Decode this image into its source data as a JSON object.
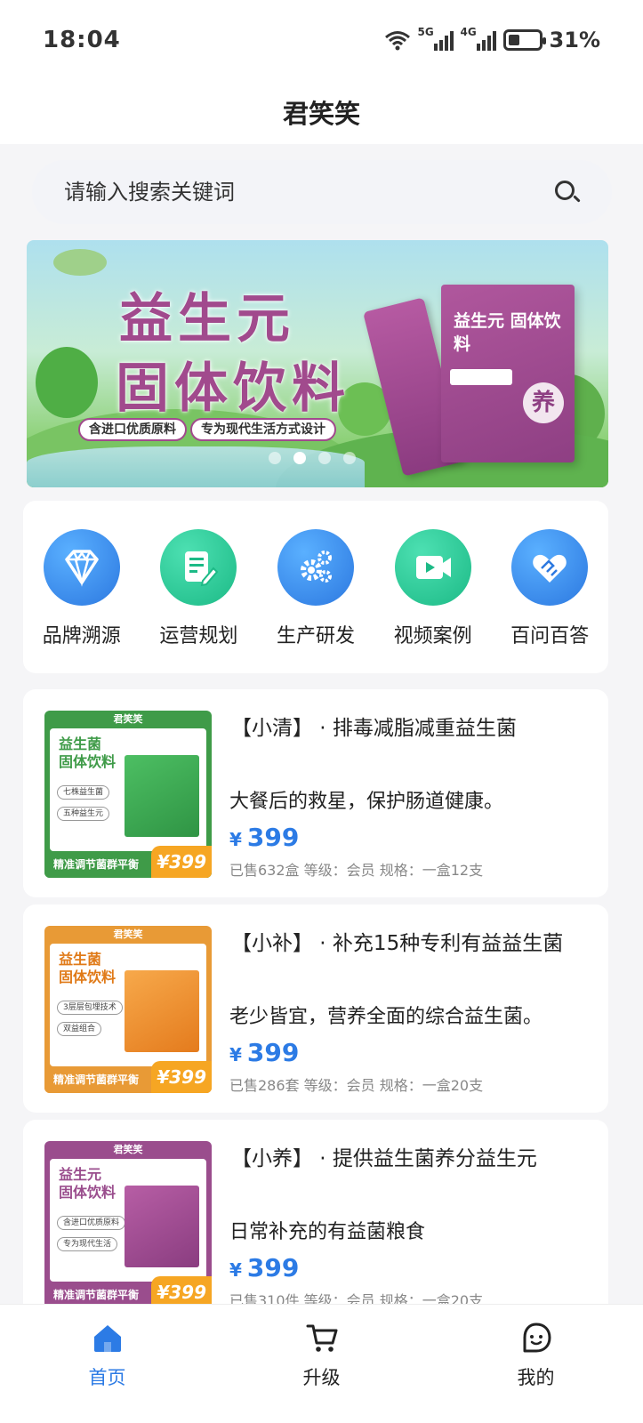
{
  "status_bar": {
    "time": "18:04",
    "network_5g": "5G",
    "network_4g": "4G",
    "battery": "31%",
    "battery_level": 0.31
  },
  "header": {
    "title": "君笑笑"
  },
  "search": {
    "placeholder": "请输入搜索关键词"
  },
  "banner": {
    "title_line1": "益生元",
    "title_line2": "固体饮料",
    "tag1": "含进口优质原料",
    "tag2": "专为现代生活方式设计",
    "package_text": "益生元 固体饮料",
    "package_seal": "养",
    "dots": 4,
    "active_dot": 1
  },
  "quick_menu": [
    {
      "label": "品牌溯源",
      "icon": "diamond-icon",
      "color": "#2c78e0"
    },
    {
      "label": "运营规划",
      "icon": "document-edit-icon",
      "color": "#1cba86"
    },
    {
      "label": "生产研发",
      "icon": "gears-icon",
      "color": "#2c78e0"
    },
    {
      "label": "视频案例",
      "icon": "video-icon",
      "color": "#1cba86"
    },
    {
      "label": "百问百答",
      "icon": "handshake-heart-icon",
      "color": "#2c78e0"
    }
  ],
  "products": [
    {
      "title": "【小清】 · 排毒减脂减重益生菌",
      "desc": "大餐后的救星，保护肠道健康。",
      "currency": "¥",
      "price": "399",
      "meta": "已售632盒  等级：会员  规格：一盒12支",
      "thumb": {
        "brand": "君笑笑",
        "title": "益生菌\n固体饮料",
        "chip1": "七株益生菌",
        "chip2": "五种益生元",
        "footer": "精准调节菌群平衡",
        "price_tag": "¥399"
      }
    },
    {
      "title": "【小补】 · 补充15种专利有益益生菌",
      "desc": "老少皆宜，营养全面的综合益生菌。",
      "currency": "¥",
      "price": "399",
      "meta": "已售286套  等级：会员  规格：一盒20支",
      "thumb": {
        "brand": "君笑笑",
        "title": "益生菌\n固体饮料",
        "chip1": "3层层包埋技术",
        "chip2": "双益组合",
        "footer": "精准调节菌群平衡",
        "price_tag": "¥399"
      }
    },
    {
      "title": "【小养】 · 提供益生菌养分益生元",
      "desc": "日常补充的有益菌粮食",
      "currency": "¥",
      "price": "399",
      "meta": "已售310件  等级：会员  规格：一盒20支",
      "thumb": {
        "brand": "君笑笑",
        "title": "益生元\n固体饮料",
        "chip1": "含进口优质原料",
        "chip2": "专为现代生活",
        "footer": "精准调节菌群平衡",
        "price_tag": "¥399"
      }
    }
  ],
  "tabbar": [
    {
      "label": "首页",
      "icon": "home-icon",
      "active": true
    },
    {
      "label": "升级",
      "icon": "cart-icon",
      "active": false
    },
    {
      "label": "我的",
      "icon": "profile-face-icon",
      "active": false
    }
  ],
  "colors": {
    "accent": "#2c7be5",
    "price": "#2c7be5",
    "banner_purple": "#a14a8d"
  }
}
